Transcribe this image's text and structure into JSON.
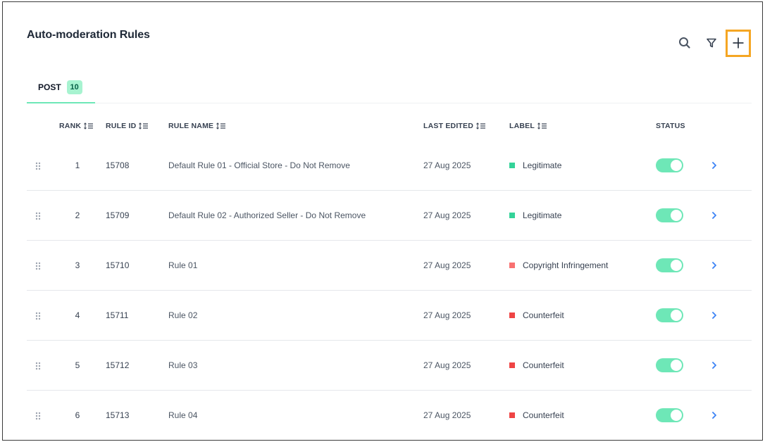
{
  "page": {
    "title": "Auto-moderation Rules"
  },
  "toolbar": {
    "search_icon": "search-icon",
    "filter_icon": "filter-icon",
    "add_icon": "plus-icon",
    "accent_highlight": "#f5a623"
  },
  "tabs": [
    {
      "label": "POST",
      "count": "10"
    }
  ],
  "table": {
    "columns": {
      "rank": "RANK",
      "rule_id": "RULE ID",
      "rule_name": "RULE NAME",
      "last_edited": "LAST EDITED",
      "label": "LABEL",
      "status": "STATUS"
    },
    "rows": [
      {
        "rank": "1",
        "rule_id": "15708",
        "rule_name": "Default Rule 01 - Official Store - Do Not Remove",
        "last_edited": "27 Aug 2025",
        "label": "Legitimate",
        "label_color": "#34d399",
        "status_on": true
      },
      {
        "rank": "2",
        "rule_id": "15709",
        "rule_name": "Default Rule 02 - Authorized Seller - Do Not Remove",
        "last_edited": "27 Aug 2025",
        "label": "Legitimate",
        "label_color": "#34d399",
        "status_on": true
      },
      {
        "rank": "3",
        "rule_id": "15710",
        "rule_name": "Rule 01",
        "last_edited": "27 Aug 2025",
        "label": "Copyright Infringement",
        "label_color": "#f87171",
        "status_on": true
      },
      {
        "rank": "4",
        "rule_id": "15711",
        "rule_name": "Rule 02",
        "last_edited": "27 Aug 2025",
        "label": "Counterfeit",
        "label_color": "#ef4444",
        "status_on": true
      },
      {
        "rank": "5",
        "rule_id": "15712",
        "rule_name": "Rule 03",
        "last_edited": "27 Aug 2025",
        "label": "Counterfeit",
        "label_color": "#ef4444",
        "status_on": true
      },
      {
        "rank": "6",
        "rule_id": "15713",
        "rule_name": "Rule 04",
        "last_edited": "27 Aug 2025",
        "label": "Counterfeit",
        "label_color": "#ef4444",
        "status_on": true
      }
    ]
  },
  "colors": {
    "toggle_on": "#6ee7b7",
    "tab_active": "#6ee7b7",
    "link": "#3b82f6"
  }
}
